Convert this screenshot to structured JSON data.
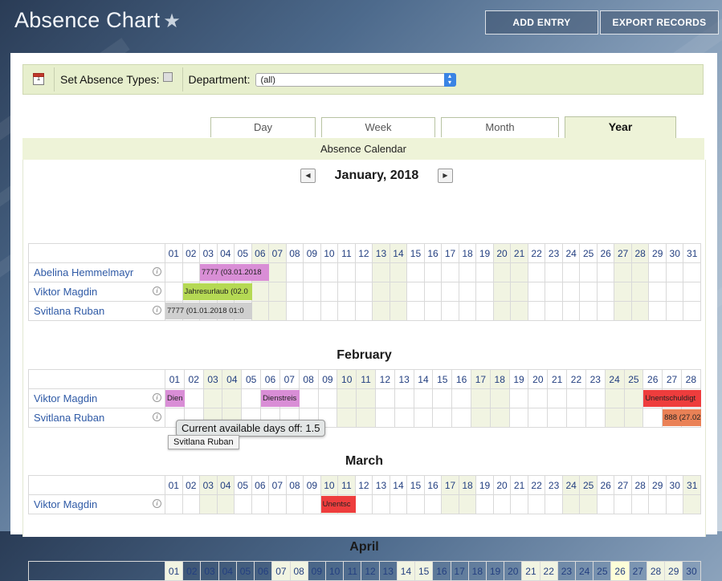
{
  "app": {
    "title": "Absence Chart",
    "star": "★"
  },
  "header_buttons": {
    "add_entry": "ADD ENTRY",
    "export_records": "EXPORT RECORDS"
  },
  "toolbar": {
    "set_absence_types": "Set Absence Types:",
    "department_label": "Department:",
    "department_value": "(all)",
    "calendar_icon_text": "1"
  },
  "tabs": [
    "Day",
    "Week",
    "Month",
    "Year"
  ],
  "active_tab": "Year",
  "section_title": "Absence Calendar",
  "nav": {
    "prev": "◀",
    "next": "▶",
    "current": "January, 2018"
  },
  "info_glyph": "i",
  "colors": {
    "weekend": "#f1f4e2",
    "pink": "#d98ed6",
    "green": "#b5d954",
    "gray": "#cfcfcf",
    "red": "#ee3d3d",
    "orange": "#ea8156"
  },
  "months": [
    {
      "title": "",
      "days": 31,
      "weekend_days": [
        6,
        7,
        13,
        14,
        20,
        21,
        27,
        28
      ],
      "rows": [
        {
          "name": "Abelina Hemmelmayr",
          "absences": [
            {
              "start": 3,
              "end": 6,
              "color": "pink",
              "label": "7777 (03.01.2018"
            }
          ]
        },
        {
          "name": "Viktor Magdin",
          "absences": [
            {
              "start": 2,
              "end": 5,
              "color": "green",
              "label": "Jahresurlaub (02.0"
            }
          ]
        },
        {
          "name": "Svitlana Ruban",
          "absences": [
            {
              "start": 1,
              "end": 5,
              "color": "gray",
              "label": "7777 (01.01.2018 01:0"
            }
          ]
        }
      ]
    },
    {
      "title": "February",
      "days": 28,
      "weekend_days": [
        3,
        4,
        10,
        11,
        17,
        18,
        24,
        25
      ],
      "rows": [
        {
          "name": "Viktor Magdin",
          "absences": [
            {
              "start": 1,
              "end": 1,
              "color": "pink",
              "label": "Dien"
            },
            {
              "start": 6,
              "end": 7,
              "color": "pink",
              "label": "Dienstreis"
            },
            {
              "start": 26,
              "end": 28,
              "color": "red",
              "label": "Unentschuldigt"
            }
          ]
        },
        {
          "name": "Svitlana Ruban",
          "absences": [
            {
              "start": 27,
              "end": 28,
              "color": "orange",
              "label": "888 (27.02"
            }
          ]
        }
      ]
    },
    {
      "title": "March",
      "days": 31,
      "weekend_days": [
        3,
        4,
        10,
        11,
        17,
        18,
        24,
        25,
        31
      ],
      "rows": [
        {
          "name": "Viktor Magdin",
          "absences": [
            {
              "start": 10,
              "end": 11,
              "color": "red",
              "label": "Unentsc"
            }
          ]
        }
      ]
    },
    {
      "title": "April",
      "days": 30,
      "weekend_days": [
        1,
        7,
        8,
        14,
        15,
        21,
        22,
        28,
        29
      ],
      "today": 26,
      "rows": []
    }
  ],
  "tooltip": {
    "available_days": "Current available days off: 1.5",
    "employee": "Svitlana Ruban"
  }
}
